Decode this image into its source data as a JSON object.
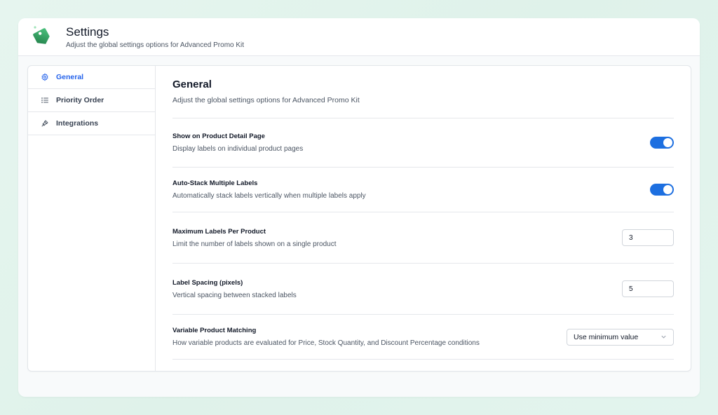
{
  "header": {
    "title": "Settings",
    "subtitle": "Adjust the global settings options for Advanced Promo Kit"
  },
  "sidebar": {
    "items": [
      {
        "label": "General",
        "icon": "gear-icon",
        "active": true
      },
      {
        "label": "Priority Order",
        "icon": "list-icon",
        "active": false
      },
      {
        "label": "Integrations",
        "icon": "plug-icon",
        "active": false
      }
    ]
  },
  "main": {
    "title": "General",
    "subtitle": "Adjust the global settings options for Advanced Promo Kit",
    "settings": [
      {
        "label": "Show on Product Detail Page",
        "desc": "Display labels on individual product pages",
        "type": "toggle",
        "on": true
      },
      {
        "label": "Auto-Stack Multiple Labels",
        "desc": "Automatically stack labels vertically when multiple labels apply",
        "type": "toggle",
        "on": true
      },
      {
        "label": "Maximum Labels Per Product",
        "desc": "Limit the number of labels shown on a single product",
        "type": "number",
        "value": "3"
      },
      {
        "label": "Label Spacing (pixels)",
        "desc": "Vertical spacing between stacked labels",
        "type": "number",
        "value": "5"
      },
      {
        "label": "Variable Product Matching",
        "desc": "How variable products are evaluated for Price, Stock Quantity, and Discount Percentage conditions",
        "type": "select",
        "value": "Use minimum value"
      }
    ]
  },
  "colors": {
    "accent": "#2563eb",
    "toggle_on": "#1d6fe0",
    "logo_green": "#2e9e5b"
  }
}
